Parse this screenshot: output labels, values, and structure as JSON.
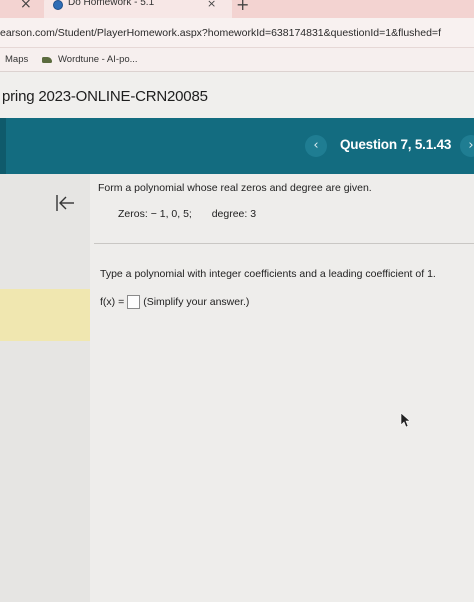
{
  "browser": {
    "tab_close_left": "×",
    "active_tab_title": "Do Homework - 5.1",
    "tab_close": "×",
    "new_tab": "+",
    "url": "earson.com/Student/PlayerHomework.aspx?homeworkId=638174831&questionId=1&flushed=f",
    "bookmarks": [
      {
        "label": "Maps"
      },
      {
        "label": "Wordtune - AI-po..."
      }
    ]
  },
  "course": {
    "title": "pring 2023-ONLINE-CRN20085"
  },
  "question_nav": {
    "prev_symbol": "‹",
    "label": "Question 7, 5.1.43",
    "next_symbol": "›"
  },
  "question": {
    "prompt": "Form a polynomial whose real zeros and degree are given.",
    "zeros_label": "Zeros:",
    "zeros_value": "− 1, 0, 5;",
    "degree_label": "degree:",
    "degree_value": "3",
    "instruction": "Type a polynomial with integer coefficients and a leading coefficient of 1.",
    "answer_prefix": "f(x) =",
    "answer_hint": "(Simplify your answer.)",
    "answer_value": ""
  }
}
